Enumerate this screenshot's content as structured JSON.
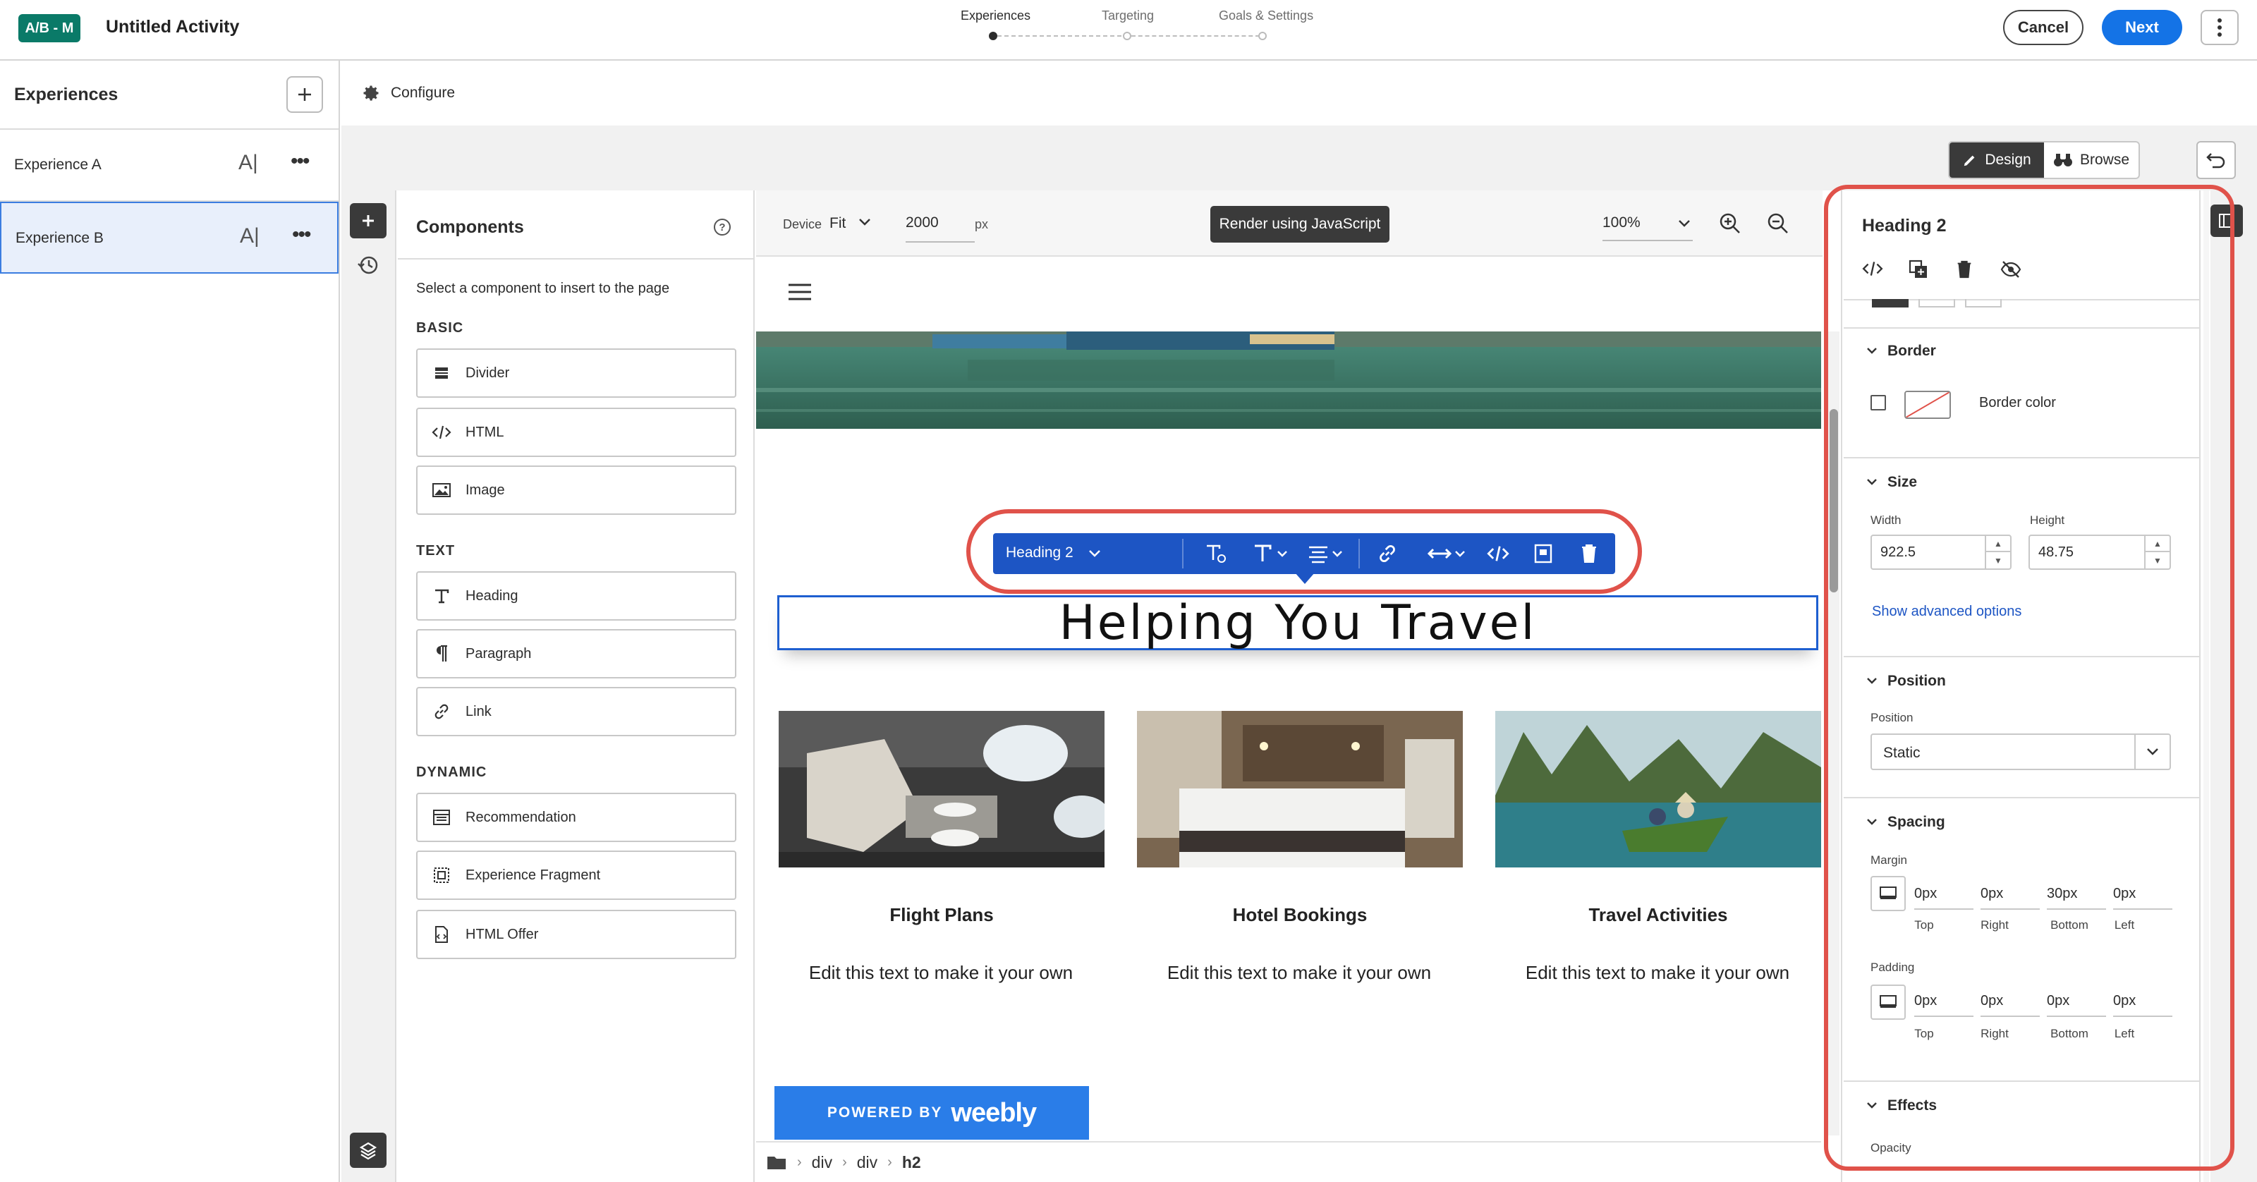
{
  "topbar": {
    "badge": "A/B - M",
    "title": "Untitled Activity",
    "steps": [
      "Experiences",
      "Targeting",
      "Goals & Settings"
    ],
    "cancel": "Cancel",
    "next": "Next"
  },
  "experiences": {
    "header": "Experiences",
    "items": [
      {
        "label": "Experience A",
        "selected": false
      },
      {
        "label": "Experience B",
        "selected": true
      }
    ],
    "rename_glyph": "A|",
    "more_glyph": "•••"
  },
  "configure_label": "Configure",
  "mode_toggle": {
    "design": "Design",
    "browse": "Browse",
    "active": "Design"
  },
  "components": {
    "title": "Components",
    "hint": "Select a component to insert to the page",
    "sections": [
      {
        "title": "BASIC",
        "items": [
          {
            "label": "Divider",
            "icon": "divider-icon"
          },
          {
            "label": "HTML",
            "icon": "code-icon"
          },
          {
            "label": "Image",
            "icon": "image-icon"
          }
        ]
      },
      {
        "title": "TEXT",
        "items": [
          {
            "label": "Heading",
            "icon": "heading-icon"
          },
          {
            "label": "Paragraph",
            "icon": "paragraph-icon"
          },
          {
            "label": "Link",
            "icon": "link-icon"
          }
        ]
      },
      {
        "title": "DYNAMIC",
        "items": [
          {
            "label": "Recommendation",
            "icon": "recommendation-icon"
          },
          {
            "label": "Experience Fragment",
            "icon": "fragment-icon"
          },
          {
            "label": "HTML Offer",
            "icon": "offer-icon"
          }
        ]
      }
    ]
  },
  "canvas_bar": {
    "device_label": "Device",
    "device_value": "Fit",
    "width_value": "2000",
    "width_unit": "px",
    "render_button": "Render using JavaScript",
    "zoom": "100%"
  },
  "page": {
    "heading": "Helping You Travel",
    "toolbar_label": "Heading 2",
    "cards": [
      {
        "title": "Flight Plans",
        "text": "Edit this text to make it your own"
      },
      {
        "title": "Hotel Bookings",
        "text": "Edit this text to make it your own"
      },
      {
        "title": "Travel Activities",
        "text": "Edit this text to make it your own"
      }
    ],
    "powered_by": "POWERED BY",
    "brand": "weebly"
  },
  "breadcrumb": [
    "div",
    "div",
    "h2"
  ],
  "properties": {
    "title": "Heading 2",
    "border": {
      "title": "Border",
      "color_label": "Border color"
    },
    "size": {
      "title": "Size",
      "width_label": "Width",
      "width": "922.5",
      "height_label": "Height",
      "height": "48.75",
      "advanced": "Show advanced options"
    },
    "position": {
      "title": "Position",
      "label": "Position",
      "value": "Static"
    },
    "spacing": {
      "title": "Spacing",
      "margin_label": "Margin",
      "margin": [
        "0px",
        "0px",
        "30px",
        "0px"
      ],
      "padding_label": "Padding",
      "padding": [
        "0px",
        "0px",
        "0px",
        "0px"
      ],
      "sides": [
        "Top",
        "Right",
        "Bottom",
        "Left"
      ]
    },
    "effects": {
      "title": "Effects",
      "opacity_label": "Opacity"
    }
  },
  "colors": {
    "accent": "#1473e6",
    "toolbar": "#1d55c4",
    "highlight": "#e0524a",
    "badge": "#0a7a68"
  }
}
